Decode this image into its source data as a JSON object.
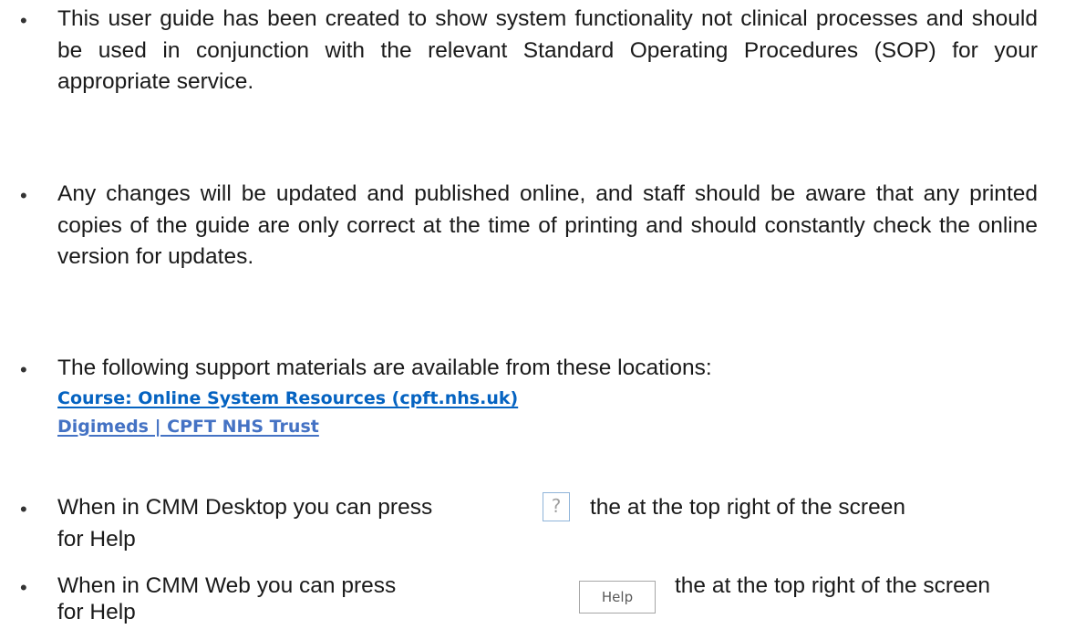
{
  "bullets": [
    {
      "text": "This user guide has been created to show system functionality not clinical processes and should be used in conjunction with the relevant Standard Operating Procedures (SOP) for your appropriate service."
    },
    {
      "text": "Any changes will be updated and published online, and staff should be aware that any printed copies of the guide are only correct at the time of printing and should constantly check the online version for updates."
    },
    {
      "text": "The following support materials are available from these locations:",
      "links": [
        {
          "label": "Course: Online System Resources (cpft.nhs.uk)"
        },
        {
          "label": "Digimeds | CPFT NHS Trust"
        }
      ]
    },
    {
      "before": "When in CMM Desktop you can press",
      "button": "?",
      "after": "the at the top right of the screen",
      "line2": "for Help"
    },
    {
      "before": "When in CMM Web you can press",
      "button": "Help",
      "after": "the at the top right of the screen",
      "line2": "for Help"
    }
  ],
  "bullet_glyph": "•",
  "colors": {
    "text": "#1a1a1a",
    "link_primary": "#0563c1",
    "link_secondary": "#4472c4",
    "help_button_border": "#8fb4d9"
  }
}
